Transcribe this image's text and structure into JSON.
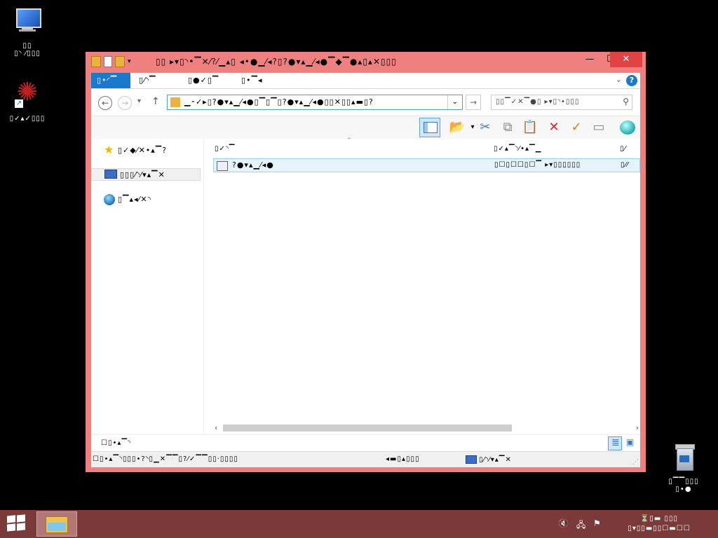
{
  "desktop": {
    "icons": [
      {
        "label": "▯\n▯⏌ ⁄▯▯▯",
        "label_line1": "▯▯",
        "label_line2": "▯◝ ⁄▯▯▯"
      },
      {
        "label_line1": "▯✓▴✓▯▯▯"
      },
      {
        "label_line1": "▯▔▔▯▯▯",
        "label_line2": "▯•●"
      }
    ]
  },
  "window": {
    "title": "▯▯ ▸▾▯◝•▔✕⁄?⁄▁▴▯ ◂•●▁⁄◂?▯?●▾▴▁⁄◂●▔◆▔●▴▯▴✕▯▯▯",
    "buttons": {
      "minimize": "—",
      "maximize": "☐",
      "close": "✕"
    },
    "ribbon_tabs": [
      "▯•◜▔",
      "▯⁄◝▔",
      "▯●✓▯▔",
      "▯•▔◂"
    ],
    "help": "?",
    "address": {
      "path": "▁⁃✓▸▯?●▾▴▁⁄◂●▯▔▯▔▯?●▾▴▁⁄◂●▯▯✕▯▯▴▬▯?",
      "search_placeholder": "▯▯▔✓✕▔●▯ ▸▾▯◝•▯▯▯"
    },
    "toolbar": {
      "organize_label": "",
      "icons": [
        "preview-pane-icon",
        "organize-icon",
        "cut-icon",
        "copy-icon",
        "paste-icon",
        "delete-icon",
        "properties-check-icon",
        "rename-icon",
        "globe-icon"
      ]
    },
    "nav_pane": {
      "favorites": "▯✓◆⁄✕•▴▔?",
      "computer": "▯▯▯⁄◝⁄▾▴▔✕",
      "network": "▯▔▴◂⁄✕◝"
    },
    "file_list": {
      "columns": {
        "name": "▯✓◝▔",
        "type": "▯✓▴▔◝⁄•▴▔▁",
        "size": "▯⁄"
      },
      "rows": [
        {
          "name": "?●▾▴▁⁄◂●",
          "type": "▯☐▯☐☐▯☐▔ ▸▾▯▯▯▯▯▯",
          "size": "▯⁄⁄"
        }
      ]
    },
    "details_text": "☐▯•▴▔◝",
    "status": {
      "left": "☐▯•▴▔◝▯▯▯•?◝▯▁✕▔▔▯?⁄✓▔▔▯▯·▯▯▯▯",
      "middle": "◂▬▯▴▯▯▯",
      "right": "▯⁄◝⁄▾▴▔✕"
    }
  },
  "taskbar": {
    "clock_time": "⏳▯▬ ▯▯▯",
    "clock_date": "▯▾▯▯▬▯▯☐▬☐☐"
  },
  "colors": {
    "window_frame": "#f08080",
    "taskbar": "#7a3a3a",
    "accent": "#1979ca"
  }
}
